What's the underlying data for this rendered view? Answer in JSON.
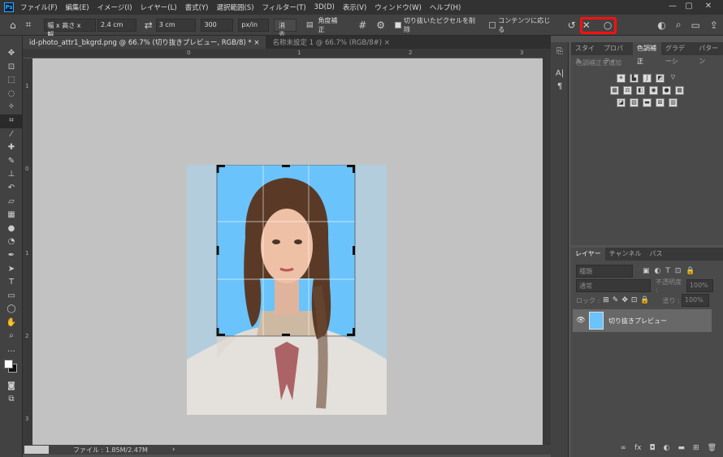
{
  "menubar": {
    "items": [
      "ファイル(F)",
      "編集(E)",
      "イメージ(I)",
      "レイヤー(L)",
      "書式(Y)",
      "選択範囲(S)",
      "フィルター(T)",
      "3D(D)",
      "表示(V)",
      "ウィンドウ(W)",
      "ヘルプ(H)"
    ],
    "app_icon": "Ps"
  },
  "window_controls": {
    "minimize": "—",
    "maximize": "▢",
    "close": "✕"
  },
  "options": {
    "ratio_preset": "幅 x 高さ x 解...",
    "width": "2.4 cm",
    "height": "3 cm",
    "resolution": "300",
    "resolution_unit": "px/in",
    "clear_label": "消去",
    "straighten_label": "角度補正",
    "delete_cropped_label": "切り抜いたピクセルを削除",
    "delete_cropped_checked": true,
    "content_aware_label": "コンテンツに応じる",
    "content_aware_checked": false,
    "commit_icon": "○",
    "highlight_color": "#ff1010"
  },
  "tabs": [
    {
      "label": "id-photo_attr1_bkgrd.png @ 66.7% (切り抜きプレビュー, RGB/8) *",
      "active": true
    },
    {
      "label": "名称未設定 1 @ 66.7% (RGB/8#)",
      "active": false
    }
  ],
  "rulers": {
    "h": [
      "0",
      "1",
      "2",
      "3"
    ],
    "v": [
      "1",
      "0",
      "1",
      "2",
      "3"
    ]
  },
  "status": {
    "file_info": "ファイル : 1.85M/2.47M",
    "arrow": "›"
  },
  "adjust_panel": {
    "tabs": [
      "スタイル",
      "プロパティ",
      "色調補正",
      "グラデーシ",
      "パターン"
    ],
    "active_tab": "色調補正",
    "add_label": "色調補正を追加"
  },
  "layers_panel": {
    "tabs": [
      "レイヤー",
      "チャンネル",
      "パス"
    ],
    "search_placeholder": "種類",
    "blend_mode": "通常",
    "opacity_label": "不透明度 :",
    "opacity_value": "100%",
    "lock_label": "ロック :",
    "fill_label": "塗り :",
    "fill_value": "100%",
    "layers": [
      {
        "name": "切り抜きプレビュー",
        "visible": true
      }
    ]
  },
  "colors": {
    "photo_bg": "#6ac3fb",
    "pasteboard": "#c2c2c2",
    "faded_bg": "#b3cddd"
  }
}
